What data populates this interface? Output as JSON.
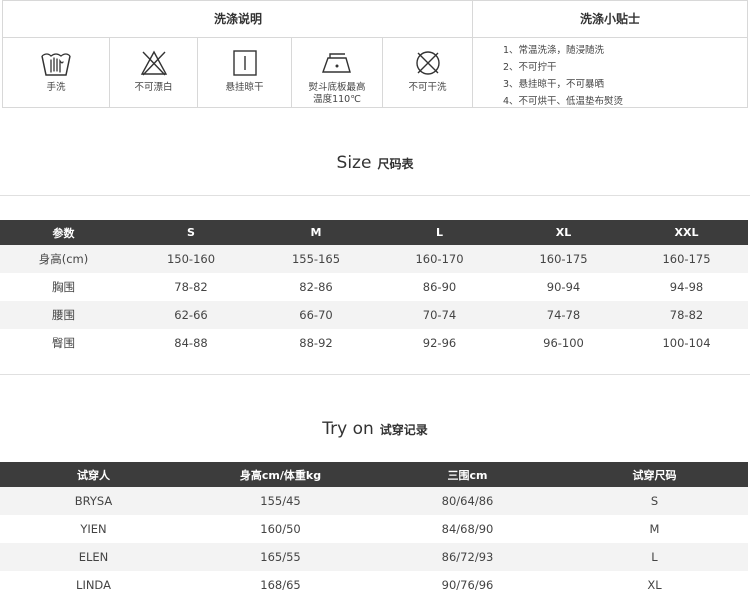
{
  "care": {
    "wash_title": "洗涤说明",
    "tips_title": "洗涤小贴士",
    "icons": [
      {
        "icon": "hand-wash-icon",
        "label": "手洗"
      },
      {
        "icon": "no-bleach-icon",
        "label": "不可漂白"
      },
      {
        "icon": "hang-dry-icon",
        "label": "悬挂晾干"
      },
      {
        "icon": "iron-icon",
        "label": "熨斗底板最高温度110℃"
      },
      {
        "icon": "no-dry-clean-icon",
        "label": "不可干洗"
      }
    ],
    "tips": [
      "1、常温洗涤，随浸随洗",
      "2、不可拧干",
      "3、悬挂晾干，不可暴晒",
      "4、不可烘干、低温垫布熨烫"
    ]
  },
  "size": {
    "title_en": "Size",
    "title_cn": "尺码表",
    "headers": [
      "参数",
      "S",
      "M",
      "L",
      "XL",
      "XXL"
    ],
    "rows": [
      [
        "身高(cm)",
        "150-160",
        "155-165",
        "160-170",
        "160-175",
        "160-175"
      ],
      [
        "胸围",
        "78-82",
        "82-86",
        "86-90",
        "90-94",
        "94-98"
      ],
      [
        "腰围",
        "62-66",
        "66-70",
        "70-74",
        "74-78",
        "78-82"
      ],
      [
        "臀围",
        "84-88",
        "88-92",
        "92-96",
        "96-100",
        "100-104"
      ]
    ]
  },
  "tryon": {
    "title_en": "Try on",
    "title_cn": "试穿记录",
    "headers": [
      "试穿人",
      "身高cm/体重kg",
      "三围cm",
      "试穿尺码"
    ],
    "rows": [
      [
        "BRYSA",
        "155/45",
        "80/64/86",
        "S"
      ],
      [
        "YIEN",
        "160/50",
        "84/68/90",
        "M"
      ],
      [
        "ELEN",
        "165/55",
        "86/72/93",
        "L"
      ],
      [
        "LINDA",
        "168/65",
        "90/76/96",
        "XL"
      ]
    ]
  }
}
